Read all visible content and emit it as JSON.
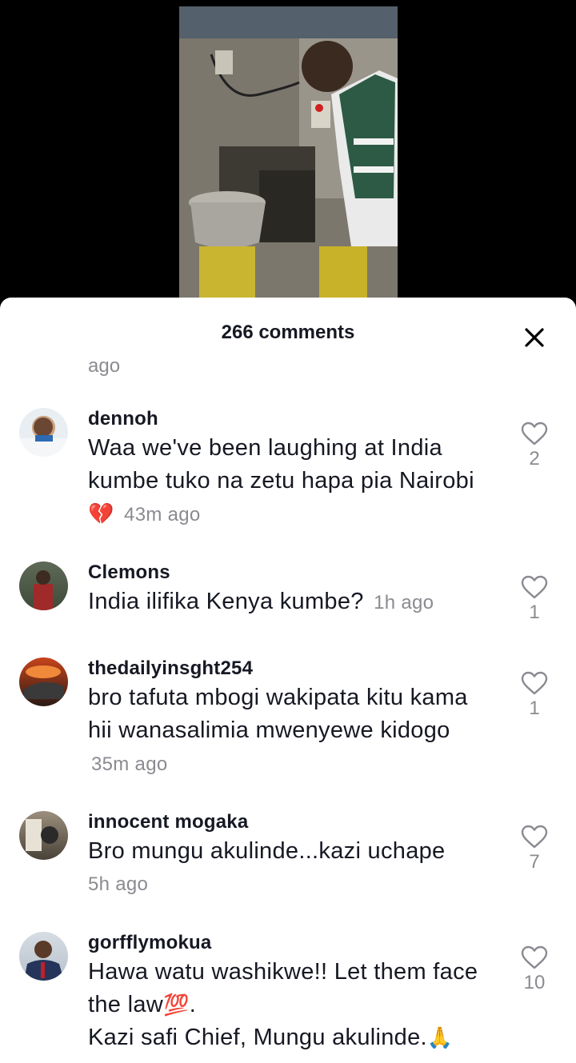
{
  "header": {
    "comments_count": "266 comments"
  },
  "truncated_time": "ago",
  "comments": [
    {
      "username": "dennoh",
      "text": "Waa we've been laughing at India kumbe tuko na zetu hapa pia Nairobi",
      "emoji": "💔",
      "time": "43m ago",
      "likes": "2"
    },
    {
      "username": "Clemons",
      "text": "India ilifika Kenya kumbe?",
      "time": "1h ago",
      "likes": "1"
    },
    {
      "username": "thedailyinsght254",
      "text": "bro tafuta mbogi wakipata kitu kama hii wanasalimia mwenyewe kidogo",
      "time": "35m ago",
      "likes": "1"
    },
    {
      "username": "innocent mogaka",
      "text": "Bro mungu akulinde...kazi uchape",
      "time": "5h ago",
      "likes": "7"
    },
    {
      "username": "gorfflymokua",
      "text_line1": "Hawa watu washikwe!! Let them face the law",
      "emoji1": "💯",
      "text_line1_end": ".",
      "text_line2": "Kazi safi Chief, Mungu akulinde.",
      "emoji2": "🙏",
      "likes": "10"
    }
  ],
  "icons": {
    "like": "heart-outline-icon",
    "close": "close-icon"
  }
}
